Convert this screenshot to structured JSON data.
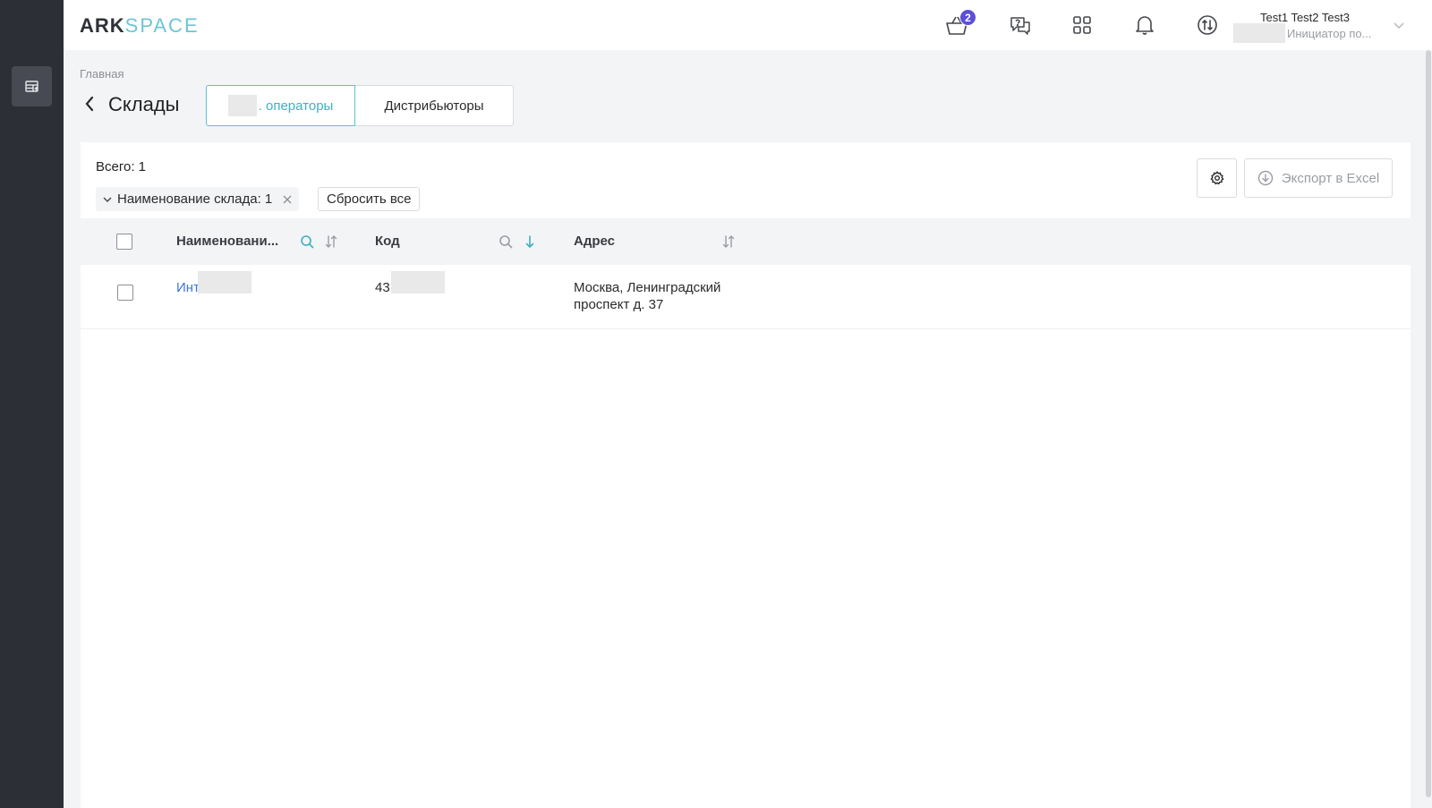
{
  "header": {
    "logo_ark": "ARK",
    "logo_space": "SPACE",
    "cart_badge": "2",
    "user": {
      "name": "Test1 Test2 Test3",
      "role": "Инициатор по..."
    }
  },
  "breadcrumb": "Главная",
  "page_title": "Склады",
  "tabs": [
    {
      "label": ". операторы",
      "active": true
    },
    {
      "label": "Дистрибьюторы",
      "active": false
    }
  ],
  "summary": {
    "total": "Всего: 1"
  },
  "filters": {
    "chip_label": "Наименование склада: 1",
    "reset_label": "Сбросить все"
  },
  "toolbar": {
    "export_label": "Экспорт в Excel"
  },
  "table": {
    "columns": [
      "Наименовани...",
      "Код",
      "Адрес"
    ],
    "rows": [
      {
        "name": "Инт",
        "code": "43",
        "address_line1": "Москва, Ленинградский",
        "address_line2": "проспект д. 37"
      }
    ]
  },
  "colors": {
    "accent": "#5ec2cf",
    "link": "#3d76d6",
    "sidebar": "#2d2f36",
    "badge": "#5b4fd6"
  }
}
